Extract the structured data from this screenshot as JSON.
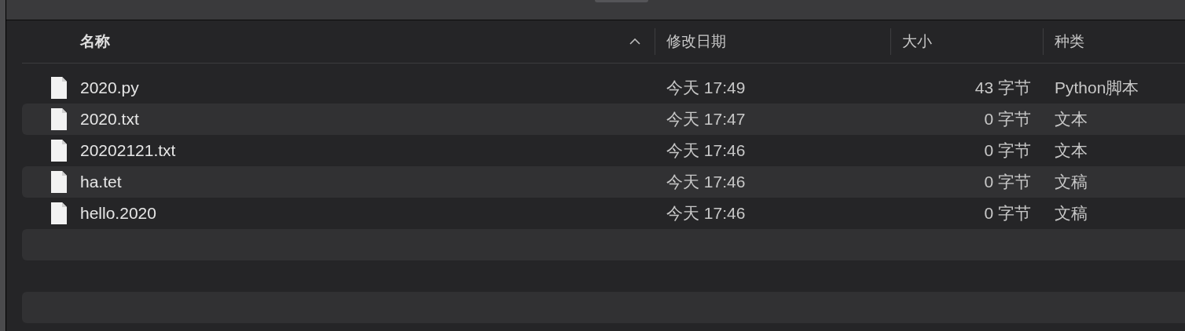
{
  "table": {
    "columns": [
      {
        "label": "名称",
        "sorted": true
      },
      {
        "label": "修改日期",
        "sorted": false
      },
      {
        "label": "大小",
        "sorted": false
      },
      {
        "label": "种类",
        "sorted": false
      }
    ],
    "rows": [
      {
        "name": "2020.py",
        "modified": "今天 17:49",
        "size": "43 字节",
        "kind": "Python脚本"
      },
      {
        "name": "2020.txt",
        "modified": "今天 17:47",
        "size": "0 字节",
        "kind": "文本"
      },
      {
        "name": "20202121.txt",
        "modified": "今天 17:46",
        "size": "0 字节",
        "kind": "文本"
      },
      {
        "name": "ha.tet",
        "modified": "今天 17:46",
        "size": "0 字节",
        "kind": "文稿"
      },
      {
        "name": "hello.2020",
        "modified": "今天 17:46",
        "size": "0 字节",
        "kind": "文稿"
      }
    ]
  }
}
